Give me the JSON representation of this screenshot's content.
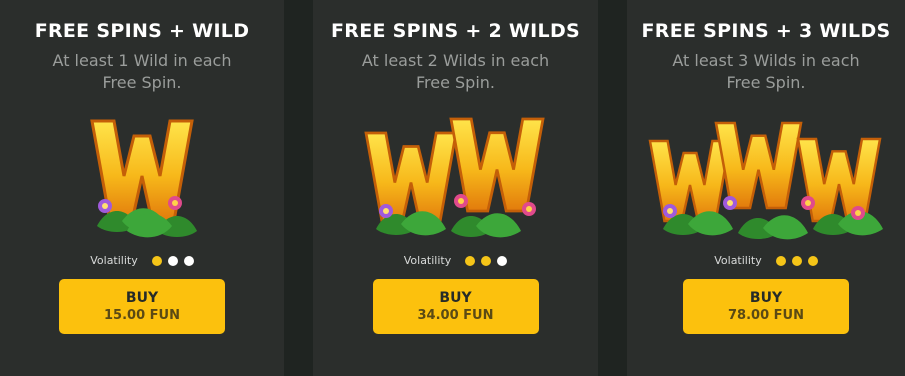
{
  "colors": {
    "background": "#2b2e2c",
    "accent": "#fcc10d",
    "dot_active": "#f5c518",
    "dot_inactive": "#ffffff"
  },
  "offers": [
    {
      "title": "FREE SPINS + WILD",
      "description": "At least 1 Wild in each Free Spin.",
      "icon": "wild-w-icon",
      "volatility_label": "Volatility",
      "volatility": 1,
      "buy_label": "BUY",
      "price": "15.00 FUN"
    },
    {
      "title": "FREE SPINS + 2 WILDS",
      "description": "At least 2 Wilds in each Free Spin.",
      "icon": "wild-ww-icon",
      "volatility_label": "Volatility",
      "volatility": 2,
      "buy_label": "BUY",
      "price": "34.00 FUN"
    },
    {
      "title": "FREE SPINS + 3 WILDS",
      "description": "At least 3 Wilds in each Free Spin.",
      "icon": "wild-www-icon",
      "volatility_label": "Volatility",
      "volatility": 3,
      "buy_label": "BUY",
      "price": "78.00 FUN"
    }
  ]
}
